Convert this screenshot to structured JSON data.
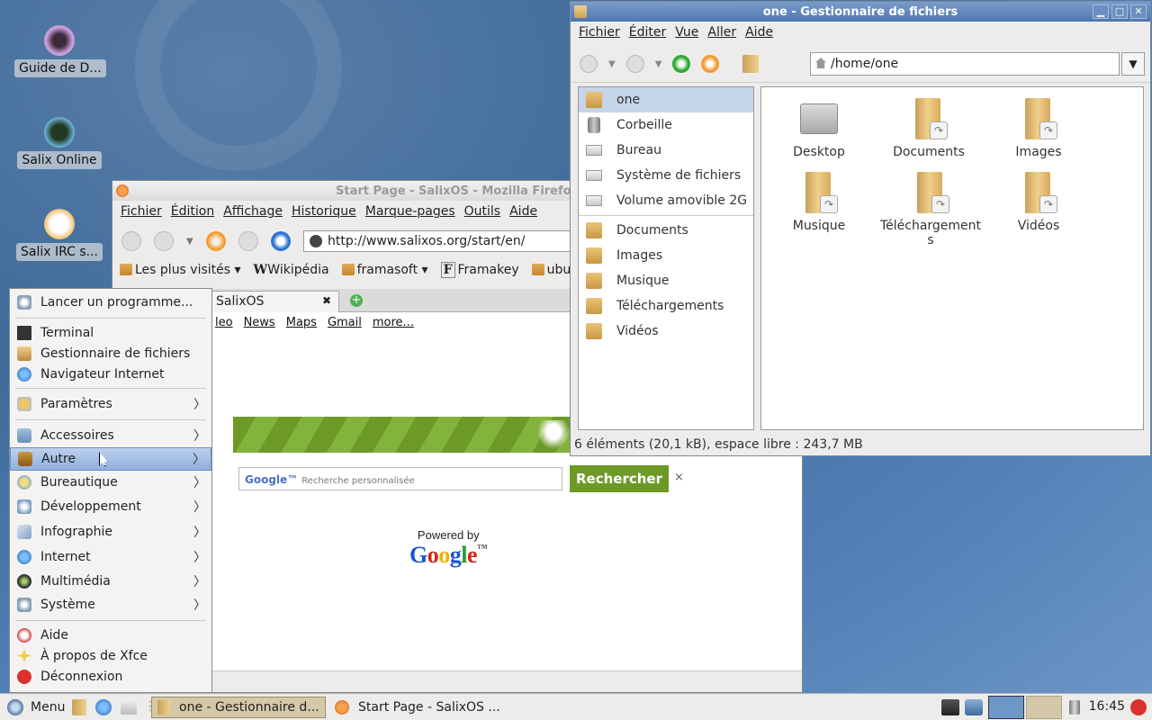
{
  "desktop": {
    "icons": [
      {
        "label": "Guide de D..."
      },
      {
        "label": "Salix Online"
      },
      {
        "label": "Salix IRC s..."
      }
    ]
  },
  "firefox": {
    "title": "Start Page - SalixOS - Mozilla Firefox",
    "menu": [
      "Fichier",
      "Édition",
      "Affichage",
      "Historique",
      "Marque-pages",
      "Outils",
      "Aide"
    ],
    "url": "http://www.salixos.org/start/en/",
    "bookmarks": [
      "Les plus visités",
      "Wikipédia",
      "framasoft",
      "Framakey",
      "ubunt"
    ],
    "tab_label": "SalixOS",
    "google_links": [
      "leo",
      "News",
      "Maps",
      "Gmail",
      "more..."
    ],
    "search_placeholder": "Recherche personnalisée",
    "search_brand": "Google™",
    "search_button": "Rechercher",
    "clear_symbol": "×",
    "powered_by": "Powered by",
    "google_logo": "Google™"
  },
  "file_manager": {
    "title": "one - Gestionnaire de fichiers",
    "menu": [
      "Fichier",
      "Éditer",
      "Vue",
      "Aller",
      "Aide"
    ],
    "path": "/home/one",
    "sidebar": [
      {
        "label": "one",
        "selected": true,
        "icon": "home-folder-icon"
      },
      {
        "label": "Corbeille",
        "icon": "trash-icon"
      },
      {
        "label": "Bureau",
        "icon": "desktop-icon"
      },
      {
        "label": "Système de fichiers",
        "icon": "drive-icon"
      },
      {
        "label": "Volume amovible 2G",
        "icon": "usb-drive-icon"
      },
      {
        "label": "Documents",
        "icon": "folder-icon"
      },
      {
        "label": "Images",
        "icon": "folder-icon"
      },
      {
        "label": "Musique",
        "icon": "folder-icon"
      },
      {
        "label": "Téléchargements",
        "icon": "folder-icon"
      },
      {
        "label": "Vidéos",
        "icon": "folder-icon"
      }
    ],
    "items": [
      "Desktop",
      "Documents",
      "Images",
      "Musique",
      "Téléchargements",
      "Vidéos"
    ],
    "status": "6 éléments (20,1 kB), espace libre : 243,7 MB"
  },
  "app_menu": {
    "run": "Lancer un programme...",
    "apps": [
      "Terminal",
      "Gestionnaire de fichiers",
      "Navigateur Internet"
    ],
    "settings": "Paramètres",
    "categories": [
      "Accessoires",
      "Autre",
      "Bureautique",
      "Développement",
      "Infographie",
      "Internet",
      "Multimédia",
      "Système"
    ],
    "highlighted": "Autre",
    "footer": [
      "Aide",
      "À propos de Xfce",
      "Déconnexion"
    ]
  },
  "taskbar": {
    "menu_label": "Menu",
    "tasks": [
      "one - Gestionnaire d...",
      "Start Page - SalixOS ..."
    ],
    "clock": "16:45"
  },
  "colors": {
    "desktop_bg": "#4f7fb5",
    "salix_green": "#6d9a26",
    "highlight": "#8fb0df"
  }
}
